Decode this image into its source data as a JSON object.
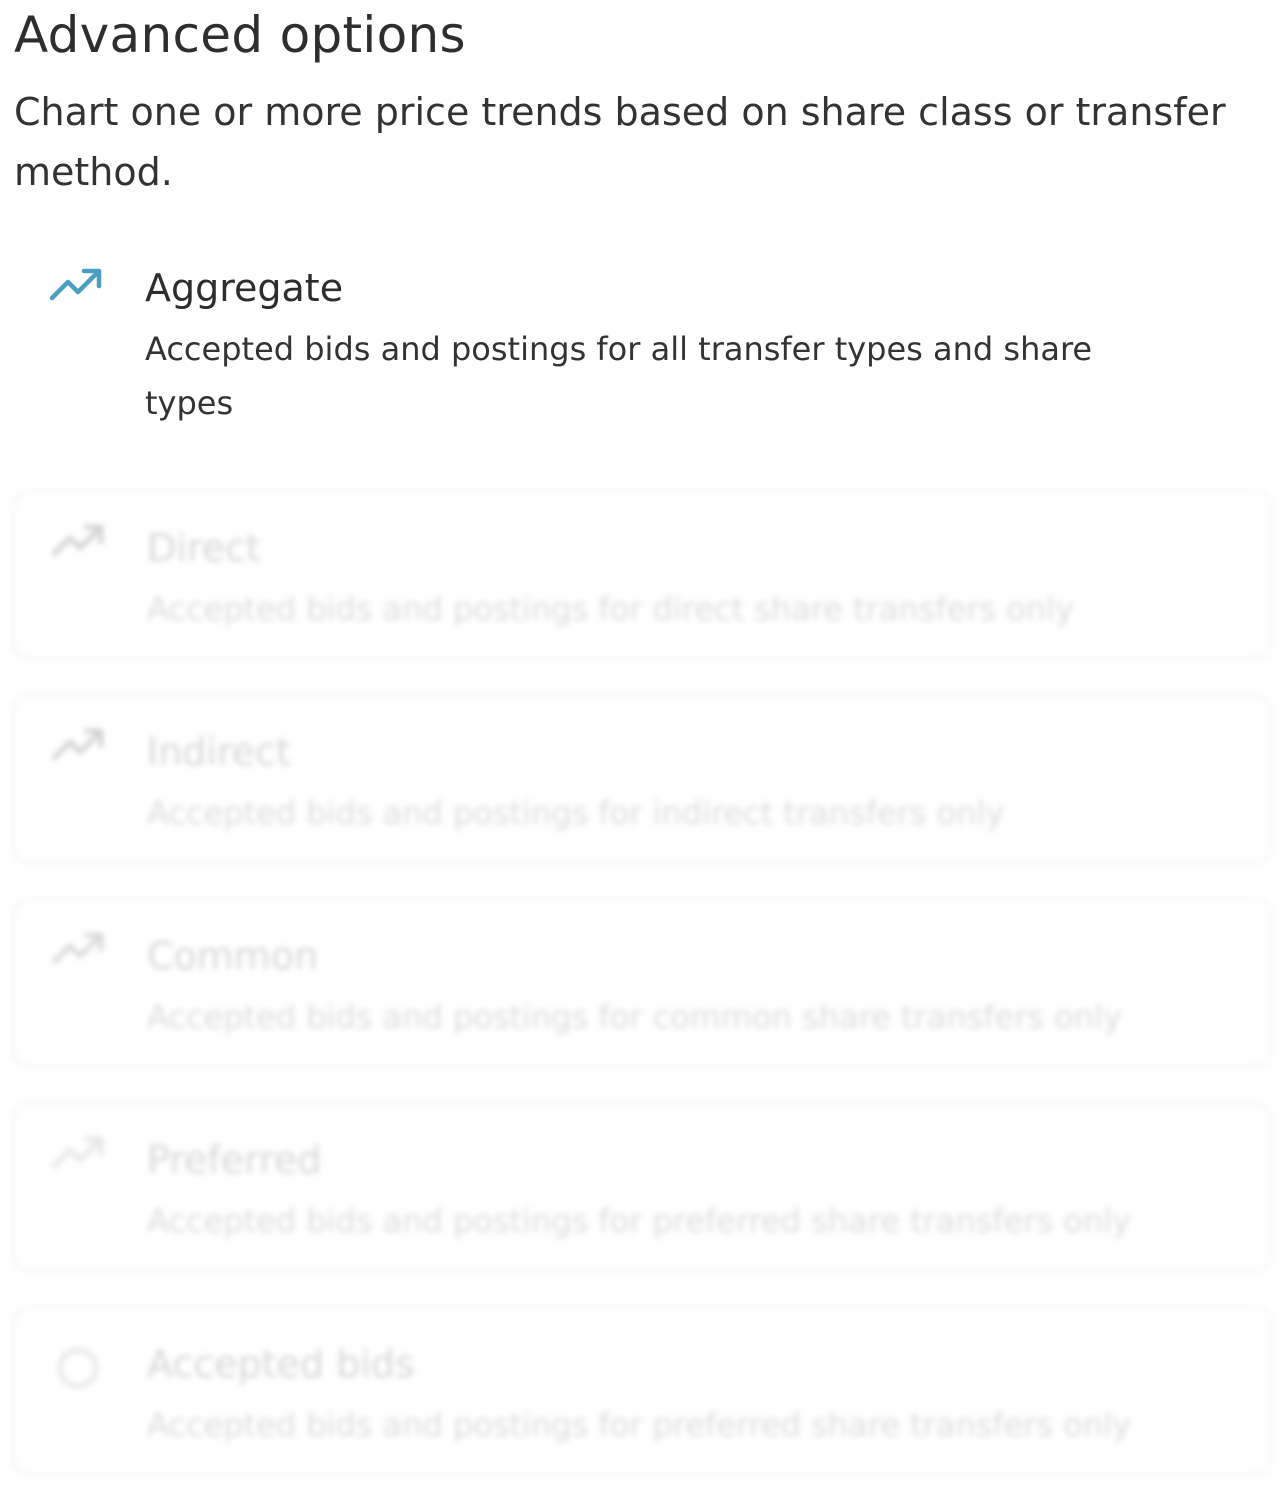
{
  "header": {
    "title": "Advanced options",
    "subtitle": "Chart one or more price trends based on share class or transfer method."
  },
  "colors": {
    "accent": "#4a9fc0",
    "disabled_icon": "#cfcfcf",
    "disabled_text": "#d6d6d6",
    "border": "#f2f2f2"
  },
  "options": [
    {
      "label": "Aggregate",
      "description": "Accepted bids and postings for all transfer types and share types",
      "icon": "trending-up-icon",
      "state": "active"
    },
    {
      "label": "Direct",
      "description": "Accepted bids and postings for direct share transfers only",
      "icon": "trending-up-icon",
      "state": "disabled"
    },
    {
      "label": "Indirect",
      "description": "Accepted bids and postings for indirect transfers only",
      "icon": "trending-up-icon",
      "state": "disabled"
    },
    {
      "label": "Common",
      "description": "Accepted bids and postings for common share transfers only",
      "icon": "trending-up-icon",
      "state": "disabled"
    },
    {
      "label": "Preferred",
      "description": "Accepted bids and postings for preferred share transfers only",
      "icon": "trending-up-icon",
      "state": "disabled"
    },
    {
      "label": "Accepted bids",
      "description": "Accepted bids and postings for preferred share transfers only",
      "icon": "radio-circle-icon",
      "state": "disabled"
    }
  ]
}
